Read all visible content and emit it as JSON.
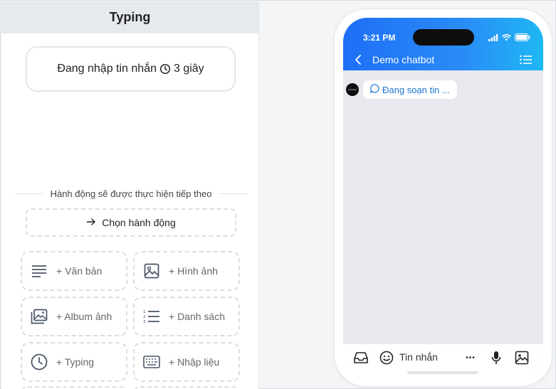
{
  "panel": {
    "title": "Typing",
    "typing_card": {
      "text": "Đang nhập tin nhắn",
      "duration": "3 giây"
    },
    "next_action_label": "Hành động sẽ được thực hiện tiếp theo",
    "choose_action_label": "Chọn hành động",
    "tiles": [
      {
        "label": "+ Văn bản",
        "icon": "text-lines-icon"
      },
      {
        "label": "+ Hình ảnh",
        "icon": "image-icon"
      },
      {
        "label": "+ Album ảnh",
        "icon": "album-icon"
      },
      {
        "label": "+ Danh sách",
        "icon": "numbered-list-icon"
      },
      {
        "label": "+ Typing",
        "icon": "clock-icon"
      },
      {
        "label": "+ Nhập liệu",
        "icon": "keyboard-icon"
      }
    ]
  },
  "phone": {
    "status_time": "3:21 PM",
    "chat_title": "Demo chatbot",
    "typing_bubble": "Đang soạn tin ...",
    "input_placeholder": "Tin nhắn",
    "more_label": "•••"
  },
  "colors": {
    "accent_start": "#1e6ff5",
    "accent_end": "#1fb8f4",
    "bubble_text": "#1d76d2",
    "screen_bg": "#e8e9ee"
  }
}
